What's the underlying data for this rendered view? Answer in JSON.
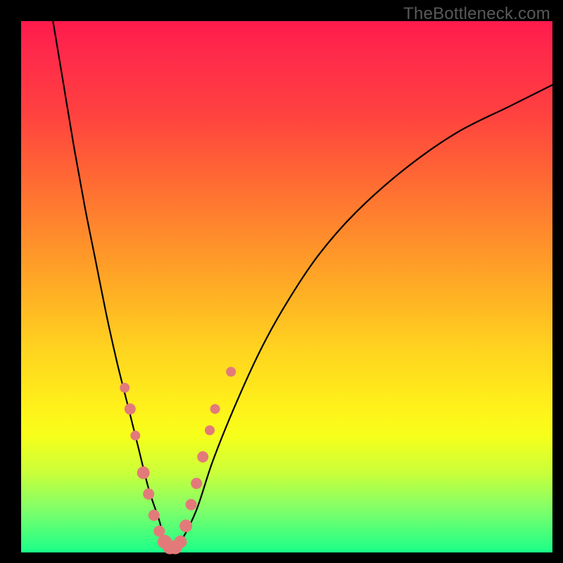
{
  "watermark": "TheBottleneck.com",
  "chart_data": {
    "type": "line",
    "title": "",
    "xlabel": "",
    "ylabel": "",
    "xlim": [
      0,
      100
    ],
    "ylim": [
      0,
      100
    ],
    "series": [
      {
        "name": "bottleneck-curve",
        "x": [
          6,
          8,
          10,
          12,
          14,
          16,
          18,
          20,
          22,
          24,
          26,
          27,
          28,
          30,
          33,
          36,
          40,
          45,
          50,
          56,
          63,
          72,
          82,
          92,
          100
        ],
        "y": [
          100,
          88,
          76,
          65,
          55,
          45,
          36,
          28,
          20,
          12,
          6,
          2,
          0,
          2,
          8,
          17,
          27,
          38,
          47,
          56,
          64,
          72,
          79,
          84,
          88
        ]
      }
    ],
    "highlight_points": {
      "name": "sample-dots",
      "points": [
        {
          "x": 19.5,
          "y": 31,
          "r": 7
        },
        {
          "x": 20.5,
          "y": 27,
          "r": 8
        },
        {
          "x": 21.5,
          "y": 22,
          "r": 7
        },
        {
          "x": 23.0,
          "y": 15,
          "r": 9
        },
        {
          "x": 24.0,
          "y": 11,
          "r": 8
        },
        {
          "x": 25.0,
          "y": 7,
          "r": 8
        },
        {
          "x": 26.0,
          "y": 4,
          "r": 8
        },
        {
          "x": 27.0,
          "y": 2,
          "r": 10
        },
        {
          "x": 28.0,
          "y": 1,
          "r": 10
        },
        {
          "x": 29.0,
          "y": 1,
          "r": 10
        },
        {
          "x": 30.0,
          "y": 2,
          "r": 9
        },
        {
          "x": 31.0,
          "y": 5,
          "r": 9
        },
        {
          "x": 32.0,
          "y": 9,
          "r": 8
        },
        {
          "x": 33.0,
          "y": 13,
          "r": 8
        },
        {
          "x": 34.2,
          "y": 18,
          "r": 8
        },
        {
          "x": 35.5,
          "y": 23,
          "r": 7
        },
        {
          "x": 36.5,
          "y": 27,
          "r": 7
        },
        {
          "x": 39.5,
          "y": 34,
          "r": 7
        }
      ]
    }
  }
}
